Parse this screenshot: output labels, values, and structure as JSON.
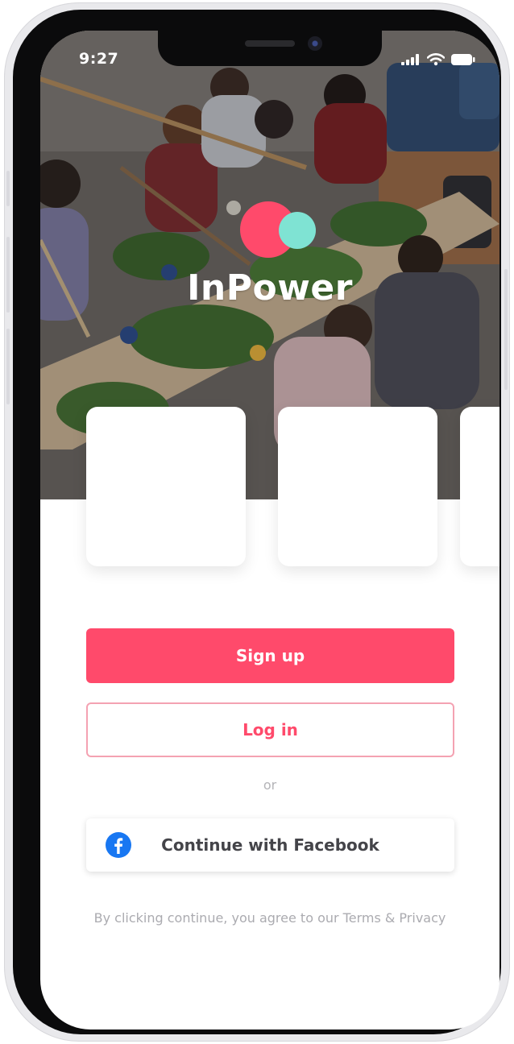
{
  "status_bar": {
    "time": "9:27",
    "icons": [
      "cellular-signal-icon",
      "wifi-icon",
      "battery-icon"
    ]
  },
  "hero": {
    "image": "group-crafting-photo",
    "brand_name": "InPower",
    "logo_colors": {
      "primary": "#ff4a6b",
      "secondary": "#7fe3d3"
    }
  },
  "cards": [
    {
      "id": "card-1"
    },
    {
      "id": "card-2"
    },
    {
      "id": "card-3"
    }
  ],
  "actions": {
    "signup_label": "Sign up",
    "login_label": "Log in",
    "or_label": "or",
    "facebook_label": "Continue with Facebook",
    "facebook_icon": "facebook-icon"
  },
  "footer": {
    "terms_text": "By clicking continue, you agree to our Terms & Privacy"
  },
  "colors": {
    "accent": "#ff4a6b",
    "accent_border": "#f4a2b2",
    "facebook_blue": "#1877f2",
    "muted_text": "#ababb0"
  }
}
